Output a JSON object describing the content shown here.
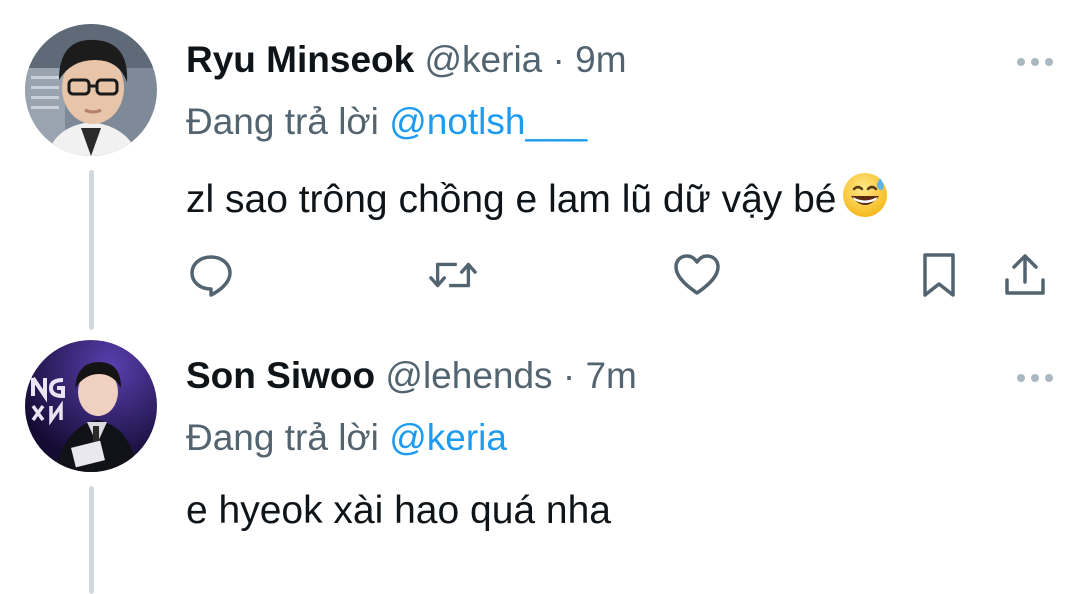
{
  "tweets": [
    {
      "display_name": "Ryu Minseok",
      "handle": "@keria",
      "separator": "·",
      "time": "9m",
      "replying_prefix": "Đang trả lời",
      "replying_to": "@notlsh___",
      "text": "zl sao trông chồng e lam lũ dữ vậy bé",
      "emoji": "grinning-face-with-sweat-emoji",
      "icons": [
        "more-icon",
        "reply-icon",
        "retweet-icon",
        "like-icon",
        "bookmark-icon",
        "share-icon"
      ]
    },
    {
      "display_name": "Son Siwoo",
      "handle": "@lehends",
      "separator": "·",
      "time": "7m",
      "replying_prefix": "Đang trả lời",
      "replying_to": "@keria",
      "text": "e hyeok xài hao quá nha",
      "icons": [
        "more-icon"
      ]
    }
  ],
  "colors": {
    "primary_text": "#0f1419",
    "secondary_text": "#536471",
    "link": "#1d9bf0",
    "thread_line": "#cfd9de"
  }
}
